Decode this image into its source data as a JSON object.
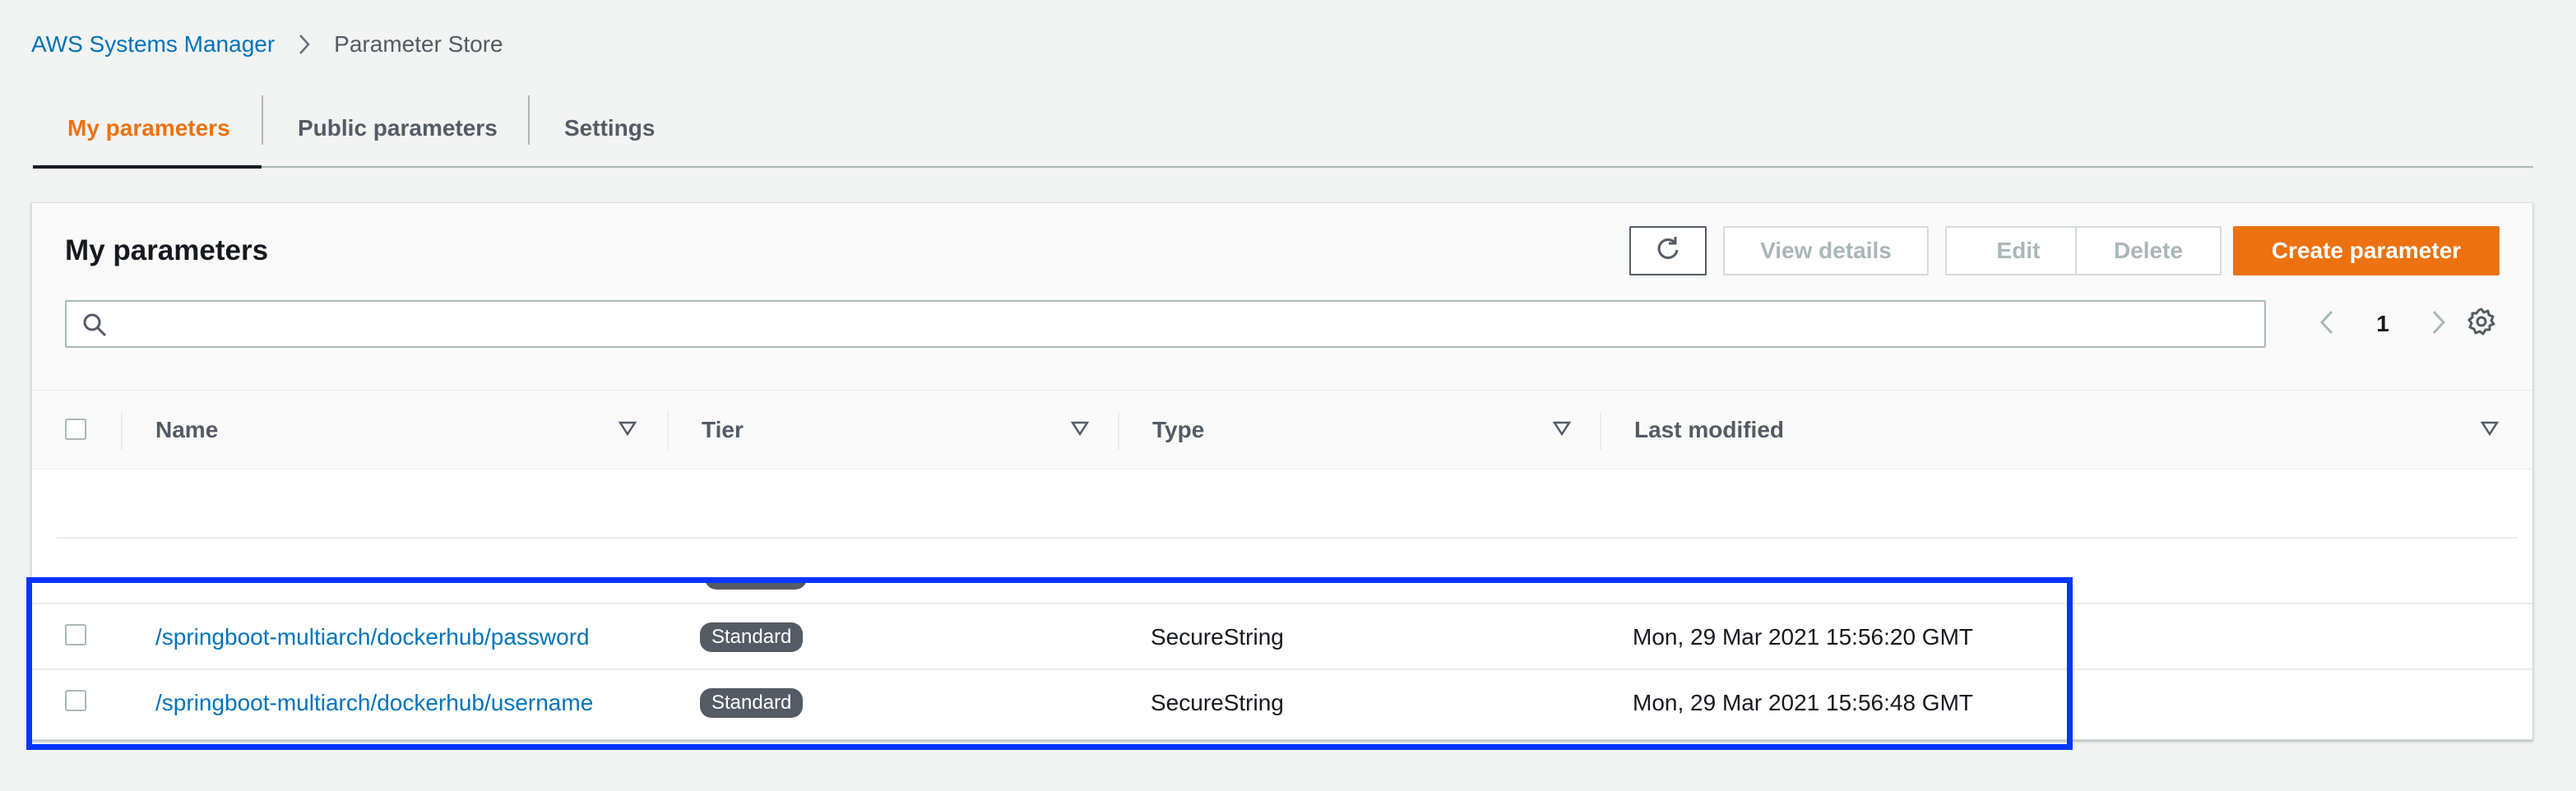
{
  "breadcrumb": {
    "root": "AWS Systems Manager",
    "current": "Parameter Store"
  },
  "tabs": [
    {
      "label": "My parameters",
      "active": true
    },
    {
      "label": "Public parameters",
      "active": false
    },
    {
      "label": "Settings",
      "active": false
    }
  ],
  "panel": {
    "title": "My parameters",
    "buttons": {
      "view_details": "View details",
      "edit": "Edit",
      "delete": "Delete",
      "create": "Create parameter"
    },
    "search": {
      "value": "",
      "placeholder": ""
    },
    "pagination": {
      "page": "1"
    }
  },
  "table": {
    "columns": [
      "Name",
      "Tier",
      "Type",
      "Last modified"
    ],
    "rows": [
      {
        "name": "/springboot-multiarch/dockerhub/password",
        "tier": "Standard",
        "type": "SecureString",
        "last_modified": "Mon, 29 Mar 2021 15:56:20 GMT"
      },
      {
        "name": "/springboot-multiarch/dockerhub/username",
        "tier": "Standard",
        "type": "SecureString",
        "last_modified": "Mon, 29 Mar 2021 15:56:48 GMT"
      }
    ]
  },
  "colors": {
    "accent": "#ec7211",
    "link": "#0073bb",
    "highlight": "#0035ff",
    "badge": "#545b64"
  },
  "icons": [
    "chevron-right-icon",
    "refresh-icon",
    "search-icon",
    "chevron-left-icon",
    "gear-icon",
    "sort-icon"
  ]
}
